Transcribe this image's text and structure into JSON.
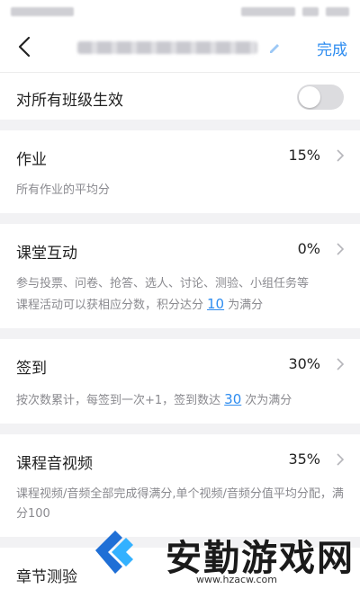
{
  "header": {
    "done_label": "完成"
  },
  "toggle_all": {
    "label": "对所有班级生效",
    "on": false
  },
  "items": [
    {
      "title": "作业",
      "value": "15%",
      "desc": "所有作业的平均分"
    },
    {
      "title": "课堂互动",
      "value": "0%",
      "desc_line1": "参与投票、问卷、抢答、选人、讨论、测验、小组任务等",
      "desc_line2_pre": "课程活动可以获相应分数，积分达分",
      "desc_num": "10",
      "desc_line2_post": "为满分"
    },
    {
      "title": "签到",
      "value": "30%",
      "desc_pre": "按次数累计，每签到一次+1，签到数达",
      "desc_num": "30",
      "desc_post": "次为满分"
    },
    {
      "title": "课程音视频",
      "value": "35%",
      "desc": "课程视频/音频全部完成得满分,单个视频/音频分值平均分配，满分100"
    },
    {
      "title": "章节测验"
    }
  ],
  "watermark": {
    "text": "安勤游戏网",
    "url": "www.hzacw.com"
  },
  "colors": {
    "accent": "#2d8cf0",
    "muted_text": "#8a8a8f",
    "background": "#f2f2f4"
  }
}
